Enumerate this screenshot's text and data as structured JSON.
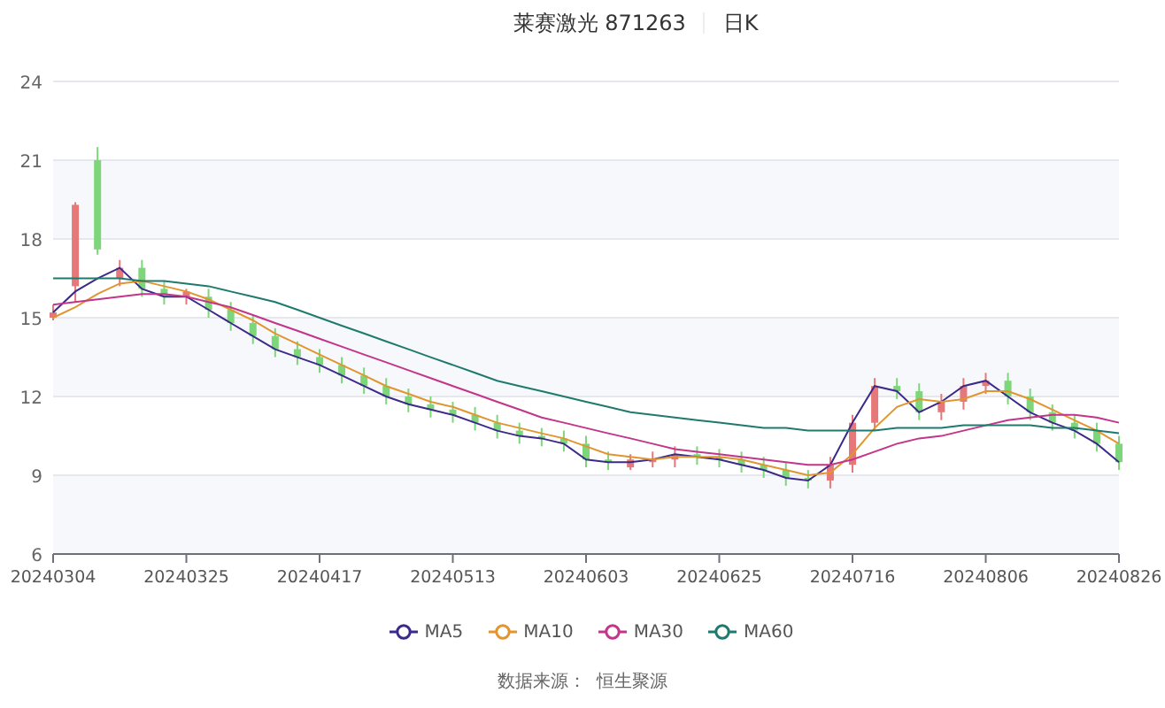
{
  "header": {
    "stock": "莱赛激光 871263",
    "period": "日K"
  },
  "chart": {
    "chart_data": {
      "type": "candlestick",
      "categories": [
        "20240304",
        null,
        null,
        null,
        null,
        null,
        "20240325",
        null,
        null,
        null,
        null,
        null,
        "20240417",
        null,
        null,
        null,
        null,
        null,
        "20240513",
        null,
        null,
        null,
        null,
        null,
        "20240603",
        null,
        null,
        null,
        null,
        null,
        "20240625",
        null,
        null,
        null,
        null,
        null,
        "20240716",
        null,
        null,
        null,
        null,
        null,
        "20240806",
        null,
        null,
        null,
        null,
        null,
        "20240826"
      ],
      "ylim": [
        6,
        24
      ],
      "grid": true,
      "yticks": [
        6,
        9,
        12,
        15,
        18,
        21,
        24
      ],
      "ohlc": [
        [
          15.0,
          15.5,
          14.9,
          15.2
        ],
        [
          16.2,
          19.4,
          15.6,
          19.3
        ],
        [
          21.0,
          21.5,
          17.4,
          17.6
        ],
        [
          16.5,
          17.2,
          16.2,
          16.9
        ],
        [
          16.9,
          17.2,
          15.8,
          16.1
        ],
        [
          16.1,
          16.4,
          15.5,
          15.8
        ],
        [
          15.8,
          16.1,
          15.5,
          16.0
        ],
        [
          15.8,
          16.1,
          15.0,
          15.3
        ],
        [
          15.3,
          15.6,
          14.5,
          14.8
        ],
        [
          14.8,
          15.1,
          14.0,
          14.3
        ],
        [
          14.3,
          14.6,
          13.5,
          13.8
        ],
        [
          13.8,
          14.1,
          13.2,
          13.5
        ],
        [
          13.5,
          13.8,
          12.9,
          13.2
        ],
        [
          13.2,
          13.5,
          12.5,
          12.8
        ],
        [
          12.8,
          13.1,
          12.1,
          12.4
        ],
        [
          12.4,
          12.7,
          11.7,
          12.0
        ],
        [
          12.0,
          12.3,
          11.4,
          11.7
        ],
        [
          11.7,
          12.0,
          11.2,
          11.5
        ],
        [
          11.5,
          11.8,
          11.0,
          11.3
        ],
        [
          11.3,
          11.6,
          10.7,
          11.0
        ],
        [
          11.0,
          11.3,
          10.4,
          10.7
        ],
        [
          10.7,
          11.0,
          10.2,
          10.5
        ],
        [
          10.5,
          10.8,
          10.1,
          10.4
        ],
        [
          10.4,
          10.7,
          9.9,
          10.2
        ],
        [
          10.2,
          10.5,
          9.3,
          9.6
        ],
        [
          9.6,
          9.9,
          9.2,
          9.5
        ],
        [
          9.3,
          9.8,
          9.2,
          9.6
        ],
        [
          9.5,
          9.9,
          9.3,
          9.6
        ],
        [
          9.6,
          10.1,
          9.3,
          9.8
        ],
        [
          9.8,
          10.1,
          9.4,
          9.7
        ],
        [
          9.7,
          10.0,
          9.3,
          9.6
        ],
        [
          9.6,
          9.9,
          9.1,
          9.4
        ],
        [
          9.4,
          9.7,
          8.9,
          9.2
        ],
        [
          9.2,
          9.5,
          8.6,
          8.9
        ],
        [
          8.9,
          9.2,
          8.5,
          8.8
        ],
        [
          8.8,
          9.7,
          8.5,
          9.4
        ],
        [
          9.4,
          11.3,
          9.1,
          11.0
        ],
        [
          11.0,
          12.7,
          10.7,
          12.4
        ],
        [
          12.4,
          12.7,
          11.9,
          12.2
        ],
        [
          12.2,
          12.5,
          11.1,
          11.4
        ],
        [
          11.4,
          12.1,
          11.1,
          11.8
        ],
        [
          11.8,
          12.7,
          11.5,
          12.4
        ],
        [
          12.4,
          12.9,
          12.1,
          12.6
        ],
        [
          12.6,
          12.9,
          11.7,
          12.0
        ],
        [
          12.0,
          12.3,
          11.1,
          11.4
        ],
        [
          11.4,
          11.7,
          10.7,
          11.0
        ],
        [
          11.0,
          11.3,
          10.4,
          10.7
        ],
        [
          10.7,
          11.0,
          9.9,
          10.2
        ],
        [
          10.2,
          10.5,
          9.2,
          9.5
        ]
      ],
      "series": [
        {
          "name": "MA5",
          "type": "line",
          "color": "#3b2a8a",
          "values": [
            15.2,
            16.0,
            16.5,
            16.9,
            16.1,
            15.8,
            15.8,
            15.3,
            14.8,
            14.3,
            13.8,
            13.5,
            13.2,
            12.8,
            12.4,
            12.0,
            11.7,
            11.5,
            11.3,
            11.0,
            10.7,
            10.5,
            10.4,
            10.2,
            9.6,
            9.5,
            9.5,
            9.6,
            9.8,
            9.7,
            9.6,
            9.4,
            9.2,
            8.9,
            8.8,
            9.4,
            11.0,
            12.4,
            12.2,
            11.4,
            11.8,
            12.4,
            12.6,
            12.0,
            11.4,
            11.0,
            10.7,
            10.2,
            9.5
          ]
        },
        {
          "name": "MA10",
          "type": "line",
          "color": "#e0952f",
          "values": [
            15.0,
            15.4,
            15.9,
            16.3,
            16.4,
            16.2,
            16.0,
            15.7,
            15.3,
            14.9,
            14.4,
            14.0,
            13.6,
            13.2,
            12.8,
            12.4,
            12.1,
            11.8,
            11.6,
            11.3,
            11.0,
            10.8,
            10.6,
            10.4,
            10.1,
            9.8,
            9.7,
            9.6,
            9.7,
            9.7,
            9.7,
            9.6,
            9.4,
            9.2,
            9.0,
            9.1,
            9.8,
            10.8,
            11.6,
            11.9,
            11.8,
            11.9,
            12.2,
            12.2,
            11.9,
            11.5,
            11.1,
            10.7,
            10.2
          ]
        },
        {
          "name": "MA30",
          "type": "line",
          "color": "#c2358a",
          "values": [
            15.5,
            15.6,
            15.7,
            15.8,
            15.9,
            15.9,
            15.8,
            15.6,
            15.4,
            15.1,
            14.8,
            14.5,
            14.2,
            13.9,
            13.6,
            13.3,
            13.0,
            12.7,
            12.4,
            12.1,
            11.8,
            11.5,
            11.2,
            11.0,
            10.8,
            10.6,
            10.4,
            10.2,
            10.0,
            9.9,
            9.8,
            9.7,
            9.6,
            9.5,
            9.4,
            9.4,
            9.6,
            9.9,
            10.2,
            10.4,
            10.5,
            10.7,
            10.9,
            11.1,
            11.2,
            11.3,
            11.3,
            11.2,
            11.0
          ]
        },
        {
          "name": "MA60",
          "type": "line",
          "color": "#1f7a6e",
          "values": [
            16.5,
            16.5,
            16.5,
            16.5,
            16.4,
            16.4,
            16.3,
            16.2,
            16.0,
            15.8,
            15.6,
            15.3,
            15.0,
            14.7,
            14.4,
            14.1,
            13.8,
            13.5,
            13.2,
            12.9,
            12.6,
            12.4,
            12.2,
            12.0,
            11.8,
            11.6,
            11.4,
            11.3,
            11.2,
            11.1,
            11.0,
            10.9,
            10.8,
            10.8,
            10.7,
            10.7,
            10.7,
            10.7,
            10.8,
            10.8,
            10.8,
            10.9,
            10.9,
            10.9,
            10.9,
            10.8,
            10.8,
            10.7,
            10.6
          ]
        }
      ]
    }
  },
  "source": "数据来源：  恒生聚源"
}
